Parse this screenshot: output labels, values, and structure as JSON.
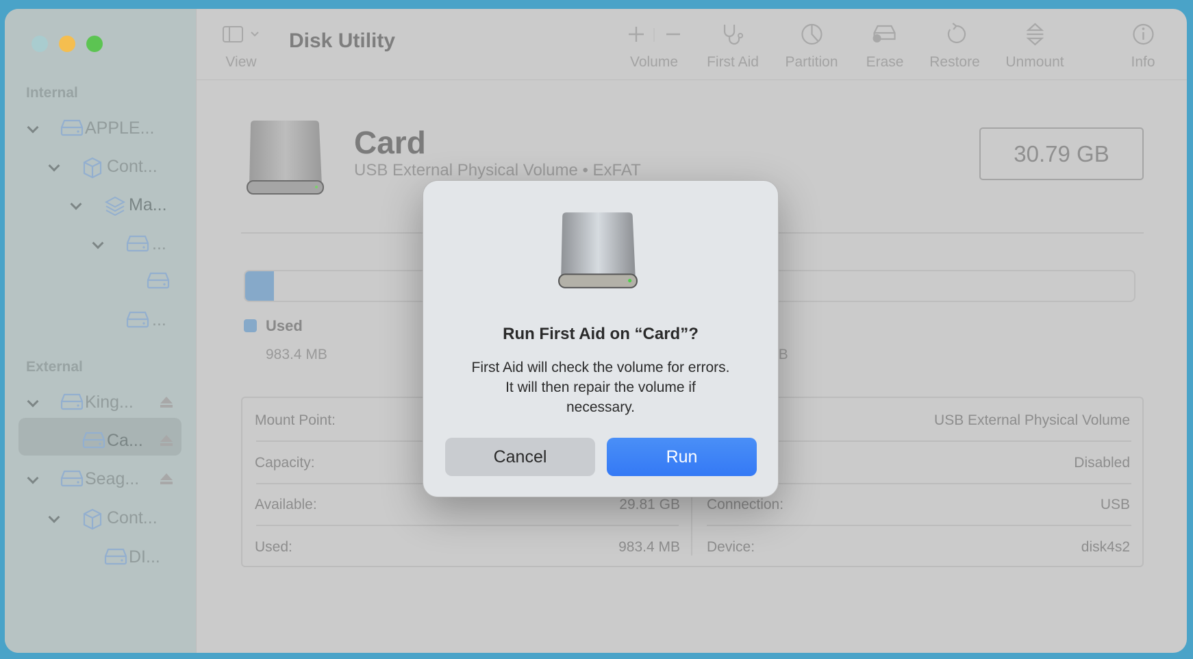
{
  "window": {
    "title": "Disk Utility",
    "view_label": "View"
  },
  "toolbar": {
    "items": [
      {
        "label": "Volume",
        "icon": "plus-minus-icon"
      },
      {
        "label": "First Aid",
        "icon": "stethoscope-icon"
      },
      {
        "label": "Partition",
        "icon": "pie-icon"
      },
      {
        "label": "Erase",
        "icon": "erase-drive-icon"
      },
      {
        "label": "Restore",
        "icon": "restore-icon"
      },
      {
        "label": "Unmount",
        "icon": "unmount-icon"
      },
      {
        "label": "Info",
        "icon": "info-icon"
      }
    ]
  },
  "sidebar": {
    "internal_header": "Internal",
    "external_header": "External",
    "internal": [
      {
        "label": "APPLE..."
      },
      {
        "label": "Cont..."
      },
      {
        "label": "Ma..."
      },
      {
        "label": "..."
      },
      {
        "label": ""
      },
      {
        "label": "..."
      }
    ],
    "external": [
      {
        "label": "King..."
      },
      {
        "label": "Ca..."
      },
      {
        "label": "Seag..."
      },
      {
        "label": "Cont..."
      },
      {
        "label": "DI..."
      }
    ]
  },
  "volume": {
    "name": "Card",
    "subtitle": "USB External Physical Volume • ExFAT",
    "size": "30.79 GB",
    "used_fraction": 0.032,
    "used_color": "#86a9c9",
    "legend": {
      "used_label": "Used",
      "used_value": "983.4 MB",
      "free_value": "29.81 GB"
    }
  },
  "info": {
    "left": [
      {
        "label": "Mount Point:",
        "value": ""
      },
      {
        "label": "Capacity:",
        "value": ""
      },
      {
        "label": "Available:",
        "value": "29.81 GB"
      },
      {
        "label": "Used:",
        "value": "983.4 MB"
      }
    ],
    "right": [
      {
        "label": "",
        "value": "USB External Physical Volume"
      },
      {
        "label": "",
        "value": "Disabled"
      },
      {
        "label": "Connection:",
        "value": "USB"
      },
      {
        "label": "Device:",
        "value": "disk4s2"
      }
    ]
  },
  "dialog": {
    "title": "Run First Aid on “Card”?",
    "message_lines": [
      "First Aid will check the volume for errors.",
      "It will then repair the volume if",
      "necessary."
    ],
    "cancel": "Cancel",
    "run": "Run",
    "accent": "#3b82f6"
  }
}
